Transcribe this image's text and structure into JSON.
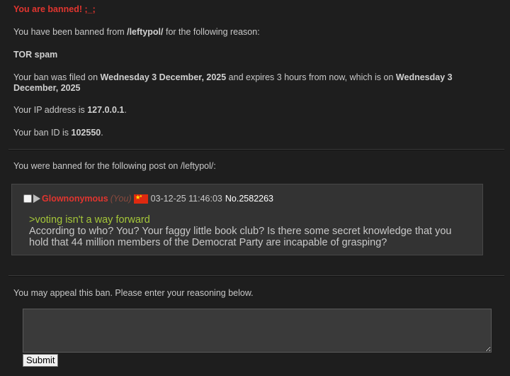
{
  "header": {
    "title": "You are banned! ;_;"
  },
  "ban": {
    "board_prefix": "You have been banned from ",
    "board": "/leftypol/",
    "board_suffix": " for the following reason:",
    "reason": "TOR spam",
    "filed_prefix": "Your ban was filed on ",
    "filed_date": "Wednesday 3 December, 2025",
    "expires_mid": " and expires 3 hours from now, which is on ",
    "expires_date": "Wednesday 3 December, 2025",
    "ip_prefix": "Your IP address is ",
    "ip": "127.0.0.1",
    "id_prefix": "Your ban ID is ",
    "id": "102550",
    "period": "."
  },
  "post_intro": "You were banned for the following post on /leftypol/:",
  "post": {
    "name": "Glownonymous",
    "you_tag": "(You)",
    "flag_icon": "china-flag-icon",
    "timestamp": "03-12-25 11:46:03",
    "number": "No.2582263",
    "quote_line": ">voting isn't a way forward",
    "body": "According to who? You? Your faggy little book club? Is there some secret knowledge that you hold that 44 million members of the Democrat Party are incapable of grasping?"
  },
  "appeal": {
    "prompt": "You may appeal this ban. Please enter your reasoning below.",
    "textarea_value": "",
    "submit_label": "Submit"
  },
  "colors": {
    "background": "#1e1e1e",
    "title_red": "#e0352f",
    "greentext": "#a4c639",
    "post_bg": "#333333"
  }
}
